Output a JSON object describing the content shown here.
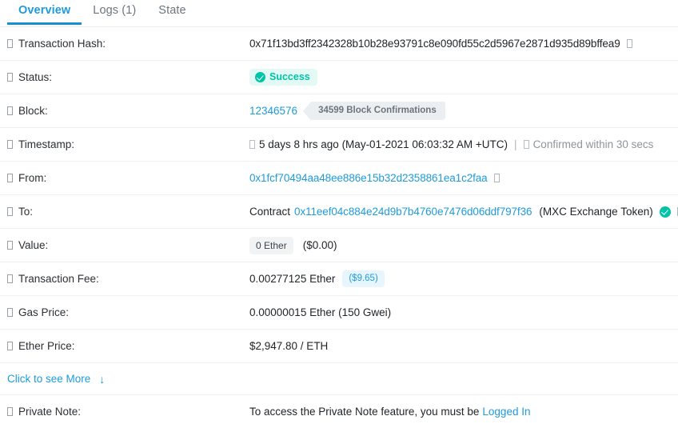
{
  "tabs": [
    {
      "label": "Overview",
      "active": true
    },
    {
      "label": "Logs (1)",
      "active": false
    },
    {
      "label": "State",
      "active": false
    }
  ],
  "colors": {
    "link": "#1f9bda",
    "success": "#00c4a7",
    "success_bg": "#e3faf4",
    "pill_blue_bg": "#e7f5fd",
    "pill_gray_bg": "#f1f3f5",
    "confirm_bg": "#eceff1",
    "tab_active": "#1a8fd0"
  },
  "rows": {
    "transaction_hash": {
      "label": "Transaction Hash:",
      "value": "0x71f13bd3ff2342328b10b28e93791c8e090fd55c2d5967e2871d935d89bffea9",
      "help_icon": "help-circle-icon",
      "copy_icon": "copy-icon"
    },
    "status": {
      "label": "Status:",
      "badge": "Success",
      "help_icon": "help-circle-icon",
      "check_icon": "check-circle-icon"
    },
    "block": {
      "label": "Block:",
      "number": "12346576",
      "confirmations": "34599 Block Confirmations",
      "help_icon": "help-circle-icon"
    },
    "timestamp": {
      "label": "Timestamp:",
      "age": "5 days 8 hrs ago (May-01-2021 06:03:32 AM +UTC)",
      "separator": "|",
      "confirmed": "Confirmed within 30 secs",
      "help_icon": "help-circle-icon",
      "clock_icon": "clock-icon",
      "confirmed_icon": "clock-icon"
    },
    "from": {
      "label": "From:",
      "address": "0x1fcf70494aa48ee886e15b32d2358861ea1c2faa",
      "help_icon": "help-circle-icon",
      "copy_icon": "copy-icon"
    },
    "to": {
      "label": "To:",
      "prefix": "Contract",
      "address": "0x11eef04c884e24d9b7b4760e7476d06ddf797f36",
      "token_name": "(MXC Exchange Token)",
      "help_icon": "help-circle-icon",
      "verified_icon": "verified-check-icon",
      "copy_icon": "copy-icon"
    },
    "value": {
      "label": "Value:",
      "ether": "0 Ether",
      "usd": "($0.00)",
      "help_icon": "help-circle-icon"
    },
    "transaction_fee": {
      "label": "Transaction Fee:",
      "ether": "0.00277125 Ether",
      "usd": "($9.65)",
      "help_icon": "help-circle-icon"
    },
    "gas_price": {
      "label": "Gas Price:",
      "value": "0.00000015 Ether (150 Gwei)",
      "help_icon": "help-circle-icon"
    },
    "ether_price": {
      "label": "Ether Price:",
      "value": "$2,947.80 / ETH",
      "help_icon": "help-circle-icon"
    },
    "see_more": {
      "label": "Click to see More",
      "arrow": "↓",
      "arrow_icon": "arrow-down-icon"
    },
    "private_note": {
      "label": "Private Note:",
      "text_before": "To access the Private Note feature, you must be",
      "link": "Logged In",
      "help_icon": "help-circle-icon"
    }
  }
}
